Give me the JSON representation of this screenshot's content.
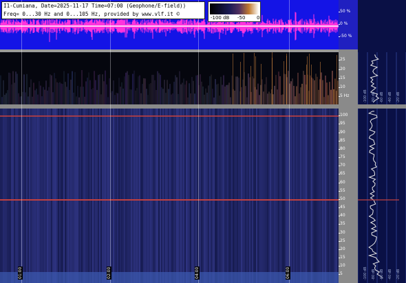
{
  "header": {
    "line1": "I1-Cumiana, Date=2025-11-17 Time=07:00 (Geophone/E-field))",
    "line2": "Freq= 0...30 Hz and 0...105 Hz, provided by www.vlf.it ©"
  },
  "colorbar": {
    "min_label": "-100 dB",
    "mid_label": "-50",
    "max_label": "0"
  },
  "waveform_axis": [
    "50 %",
    "0 %",
    "-50 %"
  ],
  "upper_freq_axis": [
    "25",
    "20",
    "15",
    "10",
    "5 Hz"
  ],
  "lower_freq_axis": [
    "100",
    "95",
    "90",
    "85",
    "80",
    "75",
    "70",
    "65",
    "60",
    "55",
    "50",
    "45",
    "40",
    "35",
    "30",
    "25",
    "20",
    "15",
    "10",
    "5"
  ],
  "time_labels": [
    "01:00",
    "02:00",
    "04:00",
    "06:00"
  ],
  "side_upper_labels": [
    "-100 dB",
    "-80 dB",
    "-60 dB",
    "-40 dB",
    "-20 dB"
  ],
  "side_lower_labels": [
    "-100 dB",
    "-80 dB",
    "-60 dB",
    "-40 dB",
    "-20 dB"
  ],
  "colors": {
    "waveform_bg": "#1414e6",
    "waveform_trace": "#ff33dd",
    "spectro_bg": "#1b2050",
    "axis_bg": "#8a8a8a",
    "side_bg": "#0a1045",
    "hum_line": "#c04040"
  }
}
